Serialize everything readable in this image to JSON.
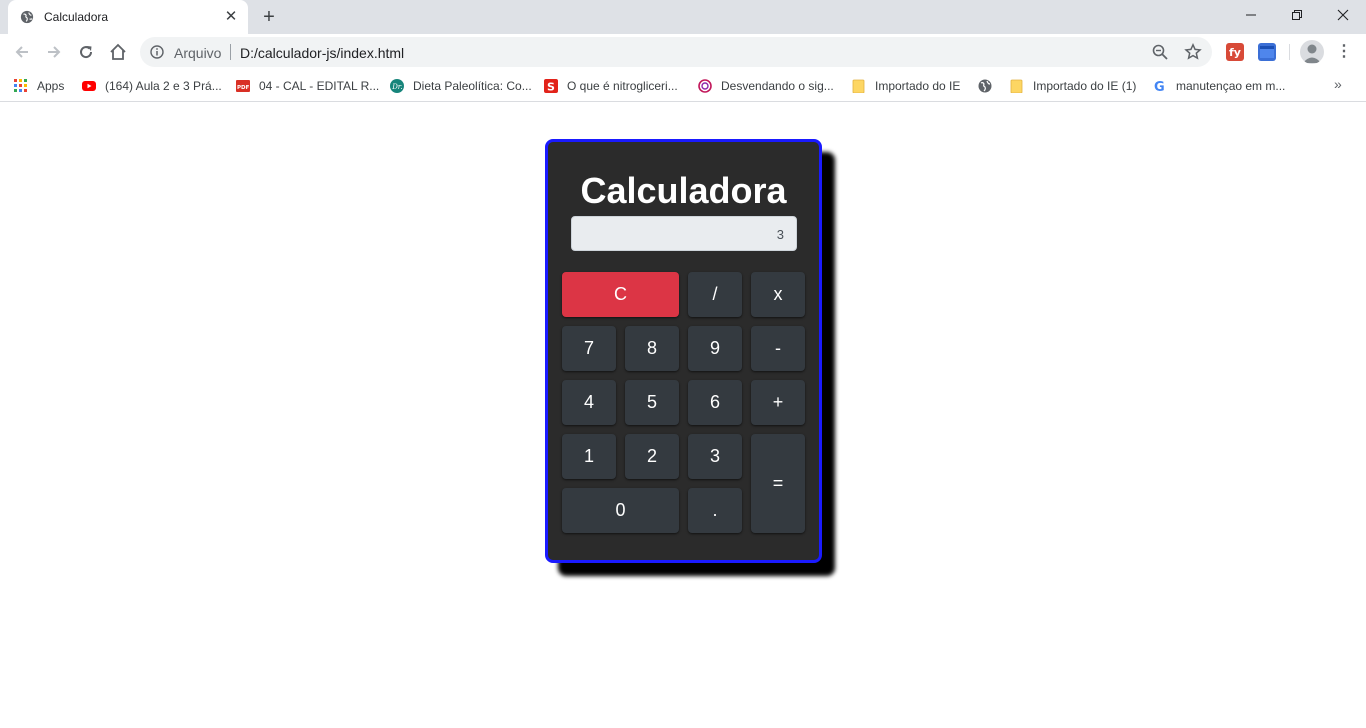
{
  "browser": {
    "tab": {
      "title": "Calculadora"
    },
    "address": {
      "scheme_label": "Arquivo",
      "url": "D:/calculador-js/index.html"
    },
    "bookmarks": [
      {
        "label": "Apps",
        "icon": "apps-grid-icon"
      },
      {
        "label": "(164) Aula 2 e 3 Prá...",
        "icon": "youtube-icon"
      },
      {
        "label": "04 - CAL - EDITAL R...",
        "icon": "pdf-icon"
      },
      {
        "label": "Dieta Paleolítica: Co...",
        "icon": "dr-icon"
      },
      {
        "label": "O que é nitrogliceri...",
        "icon": "s-icon"
      },
      {
        "label": "Desvendando o sig...",
        "icon": "swirl-icon"
      },
      {
        "label": "Importado do IE",
        "icon": "folder-icon"
      },
      {
        "label": "",
        "icon": "globe-icon"
      },
      {
        "label": "Importado do IE (1)",
        "icon": "folder-icon"
      },
      {
        "label": "manutençao em m...",
        "icon": "google-icon"
      }
    ],
    "bookmarks_more": "»"
  },
  "calculator": {
    "title": "Calculadora",
    "display": "3",
    "keys": {
      "clear": "C",
      "divide": "/",
      "multiply": "x",
      "seven": "7",
      "eight": "8",
      "nine": "9",
      "minus": "-",
      "four": "4",
      "five": "5",
      "six": "6",
      "plus": "+",
      "one": "1",
      "two": "2",
      "three": "3",
      "equals": "=",
      "zero": "0",
      "decimal": "."
    }
  },
  "colors": {
    "calculator_body": "#2b2b2b",
    "calculator_border": "#1a1aff",
    "key": "#343a40",
    "clear_key": "#dc3545",
    "display_bg": "#e9ecef"
  }
}
